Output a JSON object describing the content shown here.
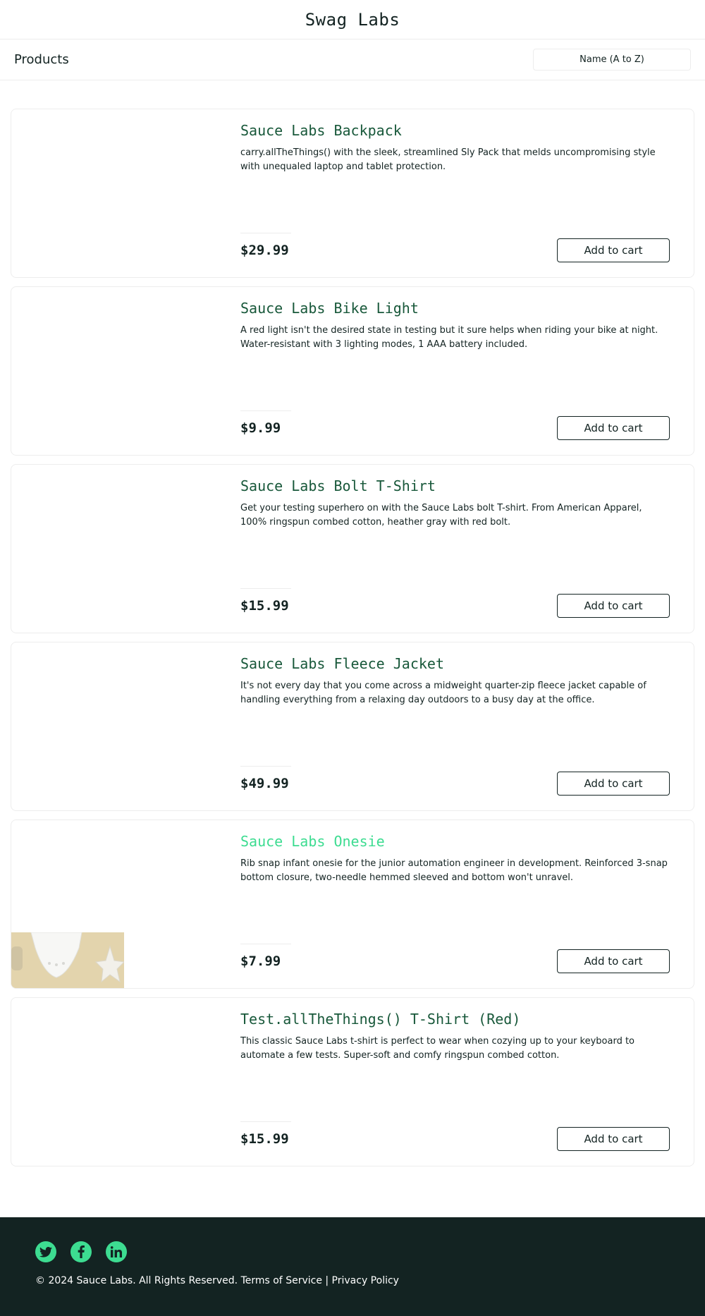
{
  "header": {
    "app_logo": "Swag Labs"
  },
  "subheader": {
    "title": "Products",
    "sort_selected": "Name (A to Z)"
  },
  "inventory": [
    {
      "name": "Sauce Labs Backpack",
      "description": "carry.allTheThings() with the sleek, streamlined Sly Pack that melds uncompromising style with unequaled laptop and tablet protection.",
      "price": "$29.99",
      "button": "Add to cart"
    },
    {
      "name": "Sauce Labs Bike Light",
      "description": "A red light isn't the desired state in testing but it sure helps when riding your bike at night. Water-resistant with 3 lighting modes, 1 AAA battery included.",
      "price": "$9.99",
      "button": "Add to cart"
    },
    {
      "name": "Sauce Labs Bolt T-Shirt",
      "description": "Get your testing superhero on with the Sauce Labs bolt T-shirt. From American Apparel, 100% ringspun combed cotton, heather gray with red bolt.",
      "price": "$15.99",
      "button": "Add to cart"
    },
    {
      "name": "Sauce Labs Fleece Jacket",
      "description": "It's not every day that you come across a midweight quarter-zip fleece jacket capable of handling everything from a relaxing day outdoors to a busy day at the office.",
      "price": "$49.99",
      "button": "Add to cart"
    },
    {
      "name": "Sauce Labs Onesie",
      "description": "Rib snap infant onesie for the junior automation engineer in development. Reinforced 3-snap bottom closure, two-needle hemmed sleeved and bottom won't unravel.",
      "price": "$7.99",
      "button": "Add to cart"
    },
    {
      "name": "Test.allTheThings() T-Shirt (Red)",
      "description": "This classic Sauce Labs t-shirt is perfect to wear when cozying up to your keyboard to automate a few tests. Super-soft and comfy ringspun combed cotton.",
      "price": "$15.99",
      "button": "Add to cart"
    }
  ],
  "footer": {
    "social": [
      "twitter-icon",
      "facebook-icon",
      "linkedin-icon"
    ],
    "copy": "© 2024 Sauce Labs. All Rights Reserved. Terms of Service | Privacy Policy"
  },
  "colors": {
    "accent": "#3ddc91",
    "item_name": "#18583a",
    "dark": "#132322",
    "border": "#ededed"
  }
}
